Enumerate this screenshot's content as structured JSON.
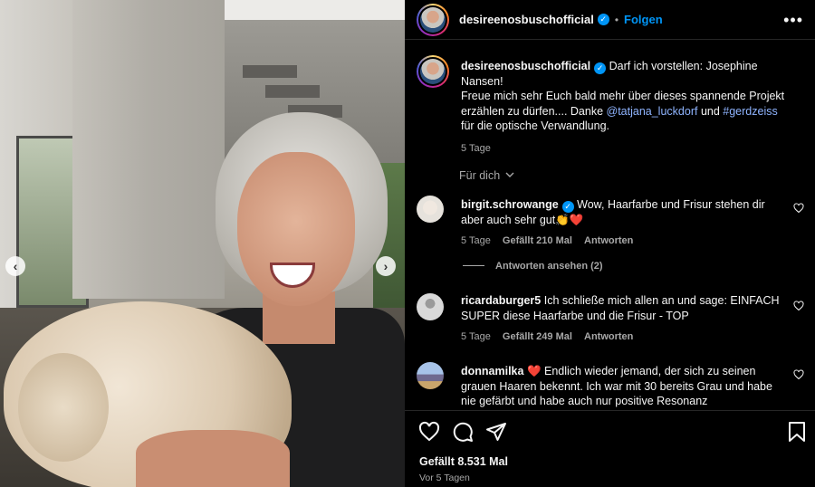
{
  "post": {
    "username": "desireenosbuschofficial",
    "separator": "•",
    "follow_label": "Folgen",
    "more_label": "•••",
    "image_alt": "Photo of a smiling woman with grey hair holding a fluffy white dog",
    "nav_prev": "‹",
    "nav_next": "›"
  },
  "caption": {
    "username": "desireenosbuschofficial",
    "text_1": "Darf ich vorstellen: Josephine Nansen!",
    "text_2": "Freue mich sehr Euch bald mehr über dieses spannende Projekt erzählen zu dürfen.... Danke ",
    "mention_1": "@tatjana_luckdorf",
    "text_3": " und ",
    "mention_2": "#gerdzeiss",
    "text_4": " für die optische Verwandlung.",
    "time": "5 Tage"
  },
  "filter": {
    "label": "Für dich",
    "chevron": "⌄"
  },
  "comments": [
    {
      "username": "birgit.schrowange",
      "verified": true,
      "text": "Wow, Haarfarbe und Frisur stehen dir aber auch sehr gut👏❤️",
      "time": "5 Tage",
      "likes": "Gefällt 210 Mal",
      "reply": "Antworten",
      "view_replies": "Antworten ansehen (2)"
    },
    {
      "username": "ricardaburger5",
      "verified": false,
      "text": "Ich schließe mich allen an und sage: EINFACH SUPER diese Haarfarbe und die Frisur - TOP",
      "time": "5 Tage",
      "likes": "Gefällt 249 Mal",
      "reply": "Antworten"
    },
    {
      "username": "donnamilka",
      "verified": false,
      "text": "❤️ Endlich wieder jemand, der sich zu seinen grauen Haaren bekennt. Ich war mit 30 bereits Grau und habe nie gefärbt und habe auch nur positive Resonanz"
    }
  ],
  "footer": {
    "likes": "Gefällt 8.531 Mal",
    "date": "Vor 5 Tagen"
  },
  "colors": {
    "accent": "#0095f6",
    "background": "#000000",
    "muted": "#a8a8a8",
    "text": "#f5f5f5"
  },
  "icons": [
    "verified-badge-icon",
    "more-options-icon",
    "chevron-down-icon",
    "heart-icon",
    "comment-icon",
    "share-icon",
    "bookmark-icon",
    "prev-arrow-icon",
    "next-arrow-icon"
  ]
}
